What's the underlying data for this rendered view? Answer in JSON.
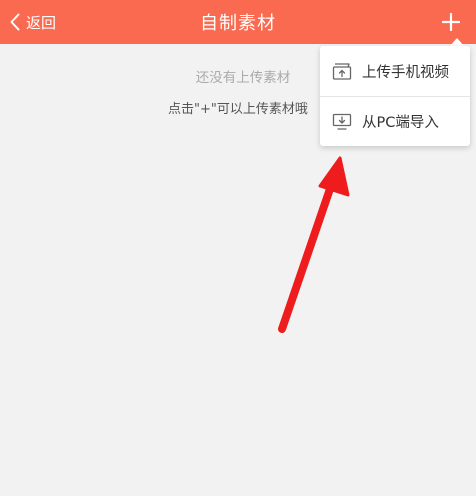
{
  "header": {
    "back_label": "返回",
    "title": "自制素材",
    "background": "#fa6a50"
  },
  "empty_state": {
    "title": "还没有上传素材",
    "hint": "点击\"+\"可以上传素材哦"
  },
  "menu": {
    "items": [
      {
        "label": "上传手机视频",
        "icon": "upload-video-icon"
      },
      {
        "label": "从PC端导入",
        "icon": "pc-import-icon"
      }
    ]
  },
  "annotation": {
    "color": "#ee1c1c"
  }
}
